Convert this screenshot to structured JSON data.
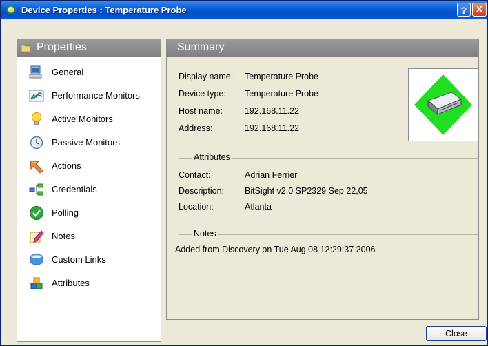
{
  "window": {
    "title": "Device Properties : Temperature Probe",
    "help_label": "?",
    "close_label": "X"
  },
  "sidebar": {
    "header": "Properties",
    "items": [
      {
        "label": "General",
        "icon": "computer-icon"
      },
      {
        "label": "Performance Monitors",
        "icon": "chart-icon"
      },
      {
        "label": "Active Monitors",
        "icon": "lightbulb-icon"
      },
      {
        "label": "Passive Monitors",
        "icon": "clock-icon"
      },
      {
        "label": "Actions",
        "icon": "arrow-icon"
      },
      {
        "label": "Credentials",
        "icon": "network-icon"
      },
      {
        "label": "Polling",
        "icon": "checkmark-icon"
      },
      {
        "label": "Notes",
        "icon": "pencil-icon"
      },
      {
        "label": "Custom Links",
        "icon": "link-icon"
      },
      {
        "label": "Attributes",
        "icon": "blocks-icon"
      }
    ]
  },
  "summary": {
    "header": "Summary",
    "display_name_label": "Display name:",
    "display_name": "Temperature Probe",
    "device_type_label": "Device type:",
    "device_type": "Temperature Probe",
    "host_name_label": "Host name:",
    "host_name": "192.168.11.22",
    "address_label": "Address:",
    "address": "192.168.11.22",
    "attributes_title": "Attributes",
    "contact_label": "Contact:",
    "contact": "Adrian Ferrier",
    "description_label": "Description:",
    "description": "BitSight v2.0 SP2329 Sep 22,05",
    "location_label": "Location:",
    "location": "Atlanta",
    "notes_title": "Notes",
    "notes_text": "Added from Discovery on Tue Aug 08 12:29:37 2006"
  },
  "footer": {
    "close_button": "Close"
  }
}
